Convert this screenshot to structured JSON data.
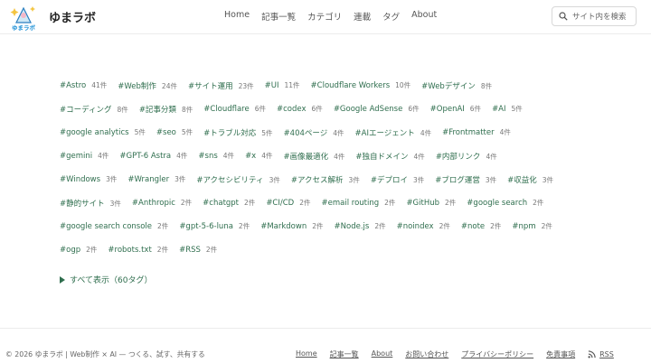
{
  "header": {
    "logo_text": "ゆまラボ",
    "brand": "ゆまラボ",
    "nav": [
      "Home",
      "記事一覧",
      "カテゴリ",
      "連載",
      "タグ",
      "About"
    ],
    "search_placeholder": "サイト内を検索"
  },
  "tags": [
    [
      [
        "#Astro",
        "41件"
      ],
      [
        "#Web制作",
        "24件"
      ],
      [
        "#サイト運用",
        "23件"
      ],
      [
        "#UI",
        "11件"
      ],
      [
        "#Cloudflare Workers",
        "10件"
      ],
      [
        "#Webデザイン",
        "8件"
      ]
    ],
    [
      [
        "#コーディング",
        "8件"
      ],
      [
        "#記事分類",
        "8件"
      ],
      [
        "#Cloudflare",
        "6件"
      ],
      [
        "#codex",
        "6件"
      ],
      [
        "#Google AdSense",
        "6件"
      ],
      [
        "#OpenAI",
        "6件"
      ],
      [
        "#AI",
        "5件"
      ]
    ],
    [
      [
        "#google analytics",
        "5件"
      ],
      [
        "#seo",
        "5件"
      ],
      [
        "#トラブル対応",
        "5件"
      ],
      [
        "#404ページ",
        "4件"
      ],
      [
        "#AIエージェント",
        "4件"
      ],
      [
        "#Frontmatter",
        "4件"
      ]
    ],
    [
      [
        "#gemini",
        "4件"
      ],
      [
        "#GPT-6 Astra",
        "4件"
      ],
      [
        "#sns",
        "4件"
      ],
      [
        "#x",
        "4件"
      ],
      [
        "#画像最適化",
        "4件"
      ],
      [
        "#独自ドメイン",
        "4件"
      ],
      [
        "#内部リンク",
        "4件"
      ]
    ],
    [
      [
        "#Windows",
        "3件"
      ],
      [
        "#Wrangler",
        "3件"
      ],
      [
        "#アクセシビリティ",
        "3件"
      ],
      [
        "#アクセス解析",
        "3件"
      ],
      [
        "#デプロイ",
        "3件"
      ],
      [
        "#ブログ運営",
        "3件"
      ],
      [
        "#収益化",
        "3件"
      ]
    ],
    [
      [
        "#静的サイト",
        "3件"
      ],
      [
        "#Anthropic",
        "2件"
      ],
      [
        "#chatgpt",
        "2件"
      ],
      [
        "#CI/CD",
        "2件"
      ],
      [
        "#email routing",
        "2件"
      ],
      [
        "#GitHub",
        "2件"
      ],
      [
        "#google search",
        "2件"
      ]
    ],
    [
      [
        "#google search console",
        "2件"
      ],
      [
        "#gpt-5-6-luna",
        "2件"
      ],
      [
        "#Markdown",
        "2件"
      ],
      [
        "#Node.js",
        "2件"
      ],
      [
        "#noindex",
        "2件"
      ],
      [
        "#note",
        "2件"
      ],
      [
        "#npm",
        "2件"
      ]
    ],
    [
      [
        "#ogp",
        "2件"
      ],
      [
        "#robots.txt",
        "2件"
      ],
      [
        "#RSS",
        "2件"
      ]
    ]
  ],
  "show_all": "すべて表示（60タグ）",
  "footer": {
    "copyright": "© 2026 ゆまラボ | Web制作 × AI — つくる、試す、共有する",
    "links": [
      "Home",
      "記事一覧",
      "About",
      "お問い合わせ",
      "プライバシーポリシー",
      "免責事項"
    ],
    "rss": "RSS"
  },
  "colors": {
    "tag": "#2f6e4e",
    "accent": "#1b8fd6"
  }
}
